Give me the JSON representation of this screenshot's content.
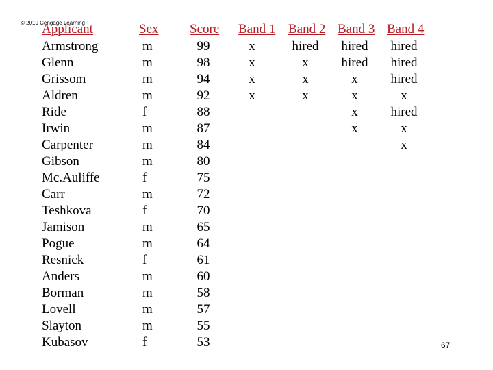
{
  "copyright": "© 2010 Cengage Learning",
  "headers": {
    "applicant": "Applicant",
    "sex": "Sex",
    "score": "Score",
    "band1": "Band 1",
    "band2": "Band 2",
    "band3": "Band 3",
    "band4": "Band 4"
  },
  "header_color": "#b81c25",
  "rows": [
    {
      "applicant": "Armstrong",
      "sex": "m",
      "score": "99",
      "band1": "x",
      "band2": "hired",
      "band3": "hired",
      "band4": "hired"
    },
    {
      "applicant": "Glenn",
      "sex": "m",
      "score": "98",
      "band1": "x",
      "band2": "x",
      "band3": "hired",
      "band4": "hired"
    },
    {
      "applicant": "Grissom",
      "sex": "m",
      "score": "94",
      "band1": "x",
      "band2": "x",
      "band3": "x",
      "band4": "hired"
    },
    {
      "applicant": "Aldren",
      "sex": "m",
      "score": "92",
      "band1": "x",
      "band2": "x",
      "band3": "x",
      "band4": "x"
    },
    {
      "applicant": "Ride",
      "sex": "f",
      "score": "88",
      "band1": "",
      "band2": "",
      "band3": "x",
      "band4": "hired"
    },
    {
      "applicant": "Irwin",
      "sex": "m",
      "score": "87",
      "band1": "",
      "band2": "",
      "band3": "x",
      "band4": "x"
    },
    {
      "applicant": "Carpenter",
      "sex": "m",
      "score": "84",
      "band1": "",
      "band2": "",
      "band3": "",
      "band4": "x"
    },
    {
      "applicant": "Gibson",
      "sex": "m",
      "score": "80",
      "band1": "",
      "band2": "",
      "band3": "",
      "band4": ""
    },
    {
      "applicant": "Mc.Auliffe",
      "sex": "f",
      "score": "75",
      "band1": "",
      "band2": "",
      "band3": "",
      "band4": ""
    },
    {
      "applicant": "Carr",
      "sex": "m",
      "score": "72",
      "band1": "",
      "band2": "",
      "band3": "",
      "band4": ""
    },
    {
      "applicant": "Teshkova",
      "sex": "f",
      "score": "70",
      "band1": "",
      "band2": "",
      "band3": "",
      "band4": ""
    },
    {
      "applicant": "Jamison",
      "sex": "m",
      "score": "65",
      "band1": "",
      "band2": "",
      "band3": "",
      "band4": ""
    },
    {
      "applicant": "Pogue",
      "sex": "m",
      "score": "64",
      "band1": "",
      "band2": "",
      "band3": "",
      "band4": ""
    },
    {
      "applicant": "Resnick",
      "sex": "f",
      "score": "61",
      "band1": "",
      "band2": "",
      "band3": "",
      "band4": ""
    },
    {
      "applicant": "Anders",
      "sex": "m",
      "score": "60",
      "band1": "",
      "band2": "",
      "band3": "",
      "band4": ""
    },
    {
      "applicant": "Borman",
      "sex": "m",
      "score": "58",
      "band1": "",
      "band2": "",
      "band3": "",
      "band4": ""
    },
    {
      "applicant": "Lovell",
      "sex": "m",
      "score": "57",
      "band1": "",
      "band2": "",
      "band3": "",
      "band4": ""
    },
    {
      "applicant": "Slayton",
      "sex": "m",
      "score": "55",
      "band1": "",
      "band2": "",
      "band3": "",
      "band4": ""
    },
    {
      "applicant": "Kubasov",
      "sex": "f",
      "score": "53",
      "band1": "",
      "band2": "",
      "band3": "",
      "band4": ""
    }
  ],
  "page_number": "67"
}
